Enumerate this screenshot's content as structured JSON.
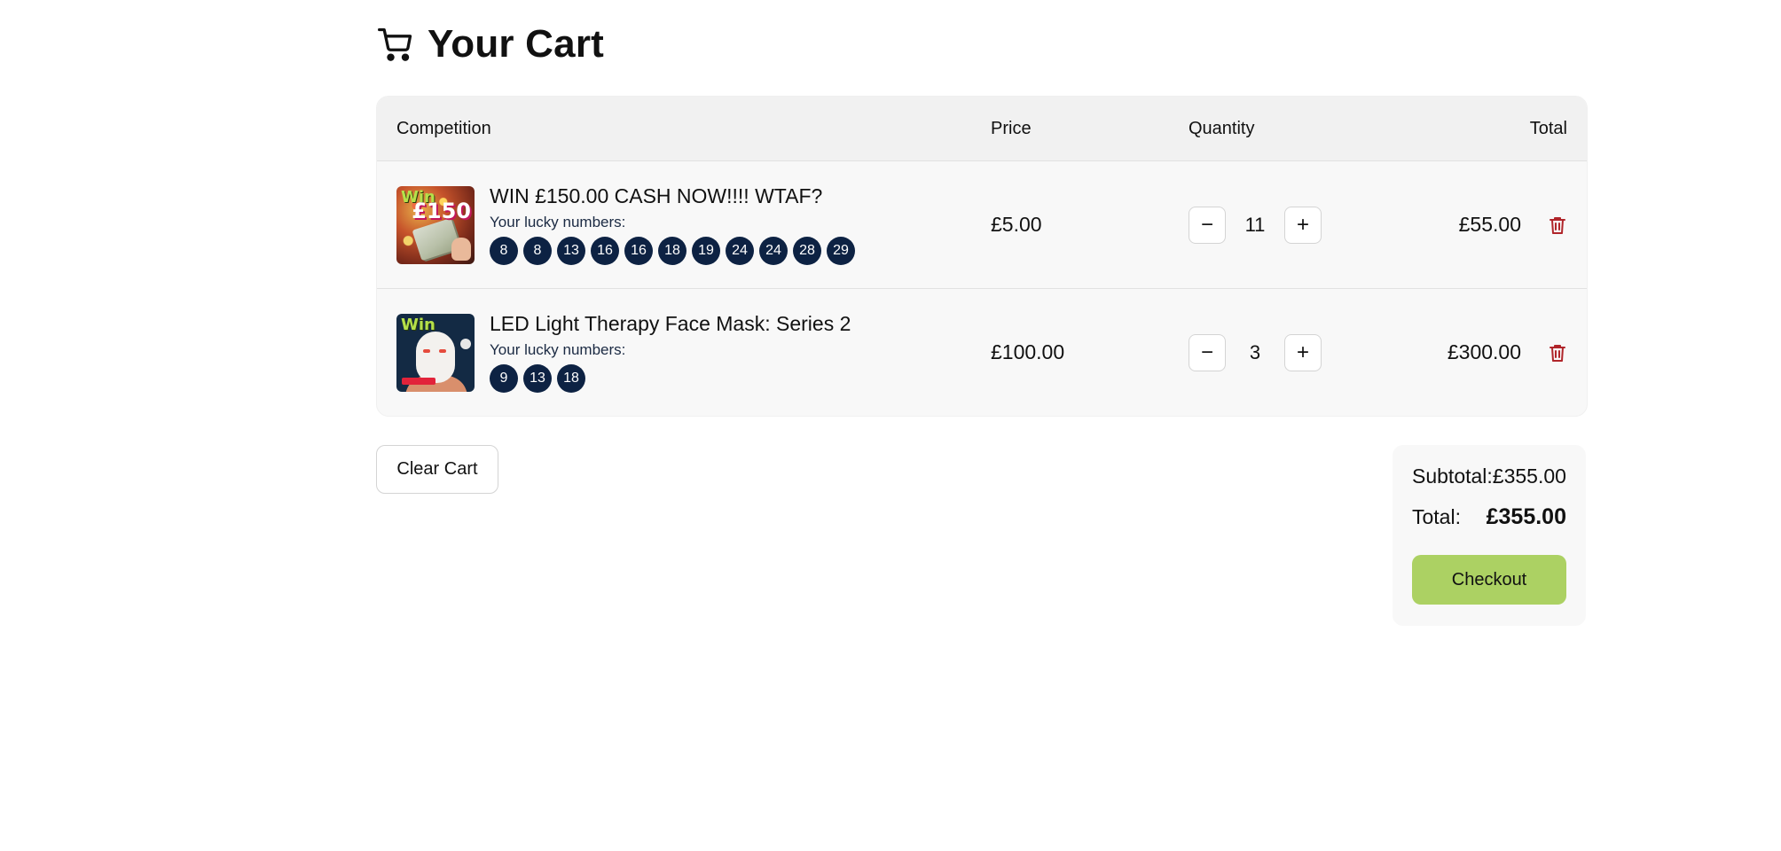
{
  "page": {
    "title": "Your Cart",
    "title_icon": "cart-icon"
  },
  "table": {
    "headers": {
      "competition": "Competition",
      "price": "Price",
      "quantity": "Quantity",
      "total": "Total"
    },
    "lucky_label": "Your lucky numbers:",
    "rows": [
      {
        "name": "WIN £150.00 CASH NOW!!!! WTAF?",
        "thumb_text_1": "Win",
        "thumb_text_2": "£150",
        "numbers": [
          "8",
          "8",
          "13",
          "16",
          "16",
          "18",
          "19",
          "24",
          "24",
          "28",
          "29"
        ],
        "price": "£5.00",
        "quantity": "11",
        "line_total": "£55.00"
      },
      {
        "name": "LED Light Therapy Face Mask: Series 2",
        "thumb_text_1": "Win",
        "numbers": [
          "9",
          "13",
          "18"
        ],
        "price": "£100.00",
        "quantity": "3",
        "line_total": "£300.00"
      }
    ],
    "qty_minus": "−",
    "qty_plus": "+"
  },
  "actions": {
    "clear_cart": "Clear Cart"
  },
  "summary": {
    "subtotal_label": "Subtotal:",
    "subtotal_value": "£355.00",
    "total_label": "Total:",
    "total_value": "£355.00",
    "checkout": "Checkout"
  },
  "colors": {
    "number_badge": "#0d2243",
    "checkout_bg": "#acd163",
    "trash": "#b0252a"
  }
}
